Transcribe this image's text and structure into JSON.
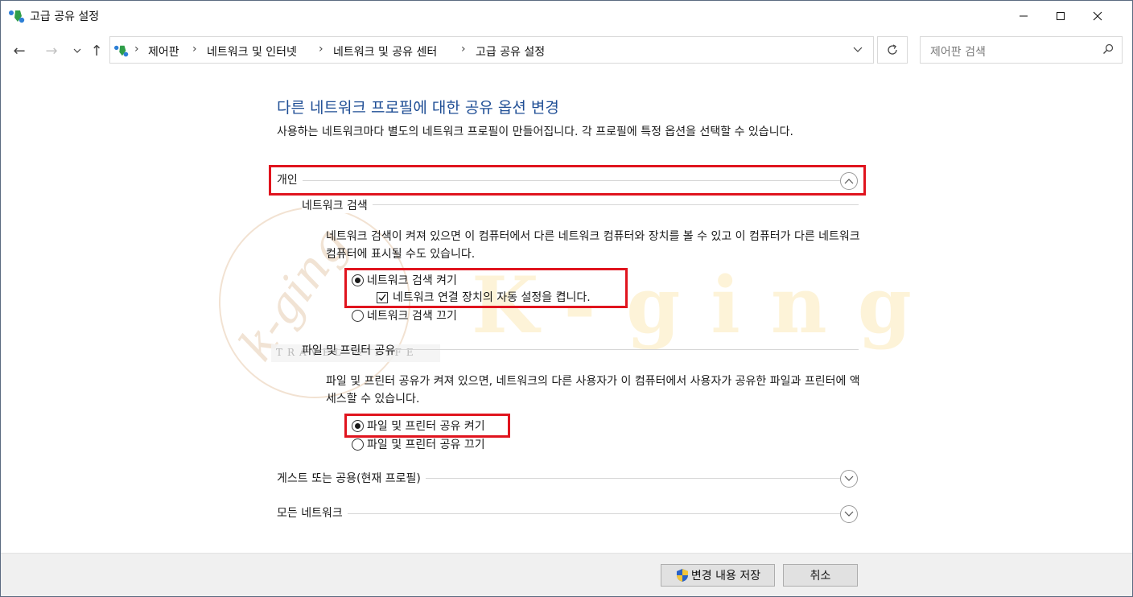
{
  "window": {
    "title": "고급 공유 설정",
    "controls": {
      "minimize": "─",
      "maximize": "☐",
      "close": "✕"
    }
  },
  "nav": {
    "back": "←",
    "forward": "→",
    "recent": "⌄",
    "up": "↑"
  },
  "address": {
    "crumbs": [
      "제어판",
      "네트워크 및 인터넷",
      "네트워크 및 공유 센터",
      "고급 공유 설정"
    ],
    "separator": "›"
  },
  "search": {
    "placeholder": "제어판 검색"
  },
  "main": {
    "heading": "다른 네트워크 프로필에 대한 공유 옵션 변경",
    "description": "사용하는 네트워크마다 별도의 네트워크 프로필이 만들어집니다. 각 프로필에 특정 옵션을 선택할 수 있습니다.",
    "private": {
      "title": "개인",
      "discovery": {
        "title": "네트워크 검색",
        "description": "네트워크 검색이 켜져 있으면 이 컴퓨터에서 다른 네트워크 컴퓨터와 장치를 볼 수 있고 이 컴퓨터가 다른 네트워크 컴퓨터에 표시될 수도 있습니다.",
        "on_label": "네트워크 검색 켜기",
        "auto_setup_label": "네트워크 연결 장치의 자동 설정을 켭니다.",
        "off_label": "네트워크 검색 끄기",
        "selected": "on",
        "auto_setup_checked": true
      },
      "sharing": {
        "title": "파일 및 프린터 공유",
        "description": "파일 및 프린터 공유가 켜져 있으면, 네트워크의 다른 사용자가 이 컴퓨터에서 사용자가 공유한 파일과 프린터에 액세스할 수 있습니다.",
        "on_label": "파일 및 프린터 공유 켜기",
        "off_label": "파일 및 프린터 공유 끄기",
        "selected": "on"
      }
    },
    "guest": {
      "title": "게스트 또는 공용(현재 프로필)"
    },
    "all": {
      "title": "모든 네트워크"
    }
  },
  "watermark": {
    "script": "k-ging",
    "brand": "K-ging",
    "sub": "TRAVEL & LIFE"
  },
  "footer": {
    "save_label": "변경 내용 저장",
    "cancel_label": "취소"
  },
  "colors": {
    "highlight": "#e0141e",
    "heading": "#1f4e95"
  }
}
